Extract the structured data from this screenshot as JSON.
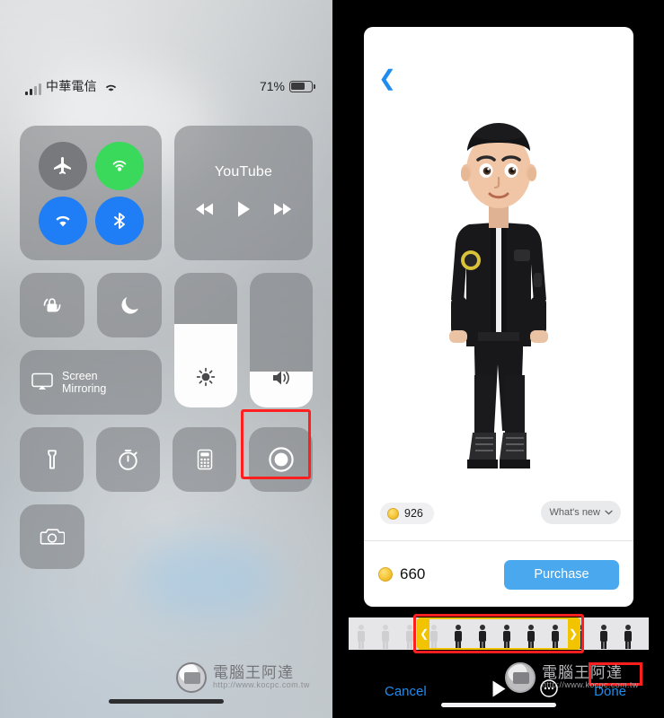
{
  "left": {
    "status_bar": {
      "carrier": "中華電信",
      "wifi_icon": "wifi-icon",
      "battery_percent": "71%",
      "battery_level": 71
    },
    "control_center": {
      "connectivity": {
        "airplane_icon": "airplane-mode-icon",
        "airdrop_icon": "airdrop-icon",
        "wifi_icon": "wifi-icon",
        "bluetooth_icon": "bluetooth-icon"
      },
      "media": {
        "title": "YouTube",
        "prev_icon": "rewind-icon",
        "play_icon": "play-icon",
        "next_icon": "fast-forward-icon"
      },
      "rotation_lock_icon": "rotation-lock-icon",
      "do_not_disturb_icon": "moon-icon",
      "brightness_icon": "brightness-icon",
      "brightness_level": 62,
      "volume_icon": "volume-icon",
      "volume_level": 27,
      "screen_mirroring": {
        "label_line1": "Screen",
        "label_line2": "Mirroring",
        "icon": "screen-mirroring-icon"
      },
      "flashlight_icon": "flashlight-icon",
      "timer_icon": "timer-icon",
      "calculator_icon": "calculator-icon",
      "screen_record_icon": "screen-record-icon",
      "camera_icon": "camera-icon"
    }
  },
  "right": {
    "back_icon": "back-chevron-icon",
    "avatar_name": "memoji-avatar",
    "owned_coins": "926",
    "whats_new_label": "What's new",
    "whats_new_icon": "chevron-down-icon",
    "price": "660",
    "purchase_label": "Purchase",
    "filmstrip": {
      "name": "frame-filmstrip",
      "selection_left_handle": "❮",
      "selection_right_handle": "❯"
    },
    "bottom_bar": {
      "cancel_label": "Cancel",
      "play_icon": "play-icon",
      "more_icon": "more-options-icon",
      "done_label": "Done"
    }
  },
  "watermark": {
    "title": "電腦王阿達",
    "url": "http://www.kocpc.com.tw"
  }
}
